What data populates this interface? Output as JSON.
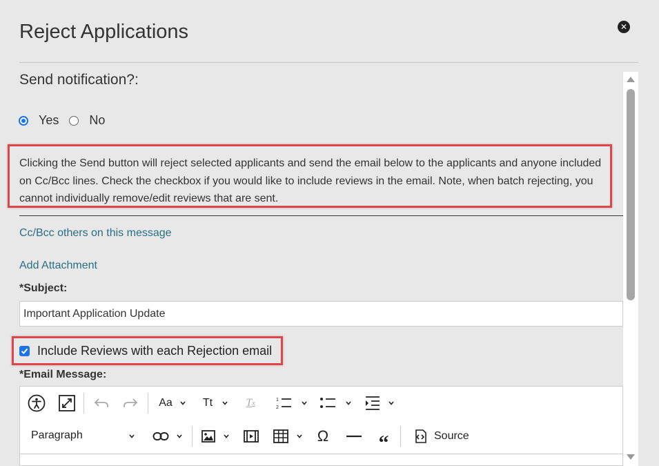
{
  "dialog": {
    "title": "Reject Applications",
    "close_icon": "close-circle-icon"
  },
  "notification": {
    "label": "Send notification?:",
    "options": [
      {
        "label": "Yes",
        "selected": true
      },
      {
        "label": "No",
        "selected": false
      }
    ]
  },
  "info_text": "Clicking the Send button will reject selected applicants and send the email below to the applicants and anyone included on Cc/Bcc lines. Check the checkbox if you would like to include reviews in the email. Note, when batch rejecting, you cannot individually remove/edit reviews that are sent.",
  "links": {
    "cc_bcc": "Cc/Bcc others on this message",
    "attachment": "Add Attachment"
  },
  "subject": {
    "label": "*Subject:",
    "value": "Important Application Update"
  },
  "include_reviews": {
    "label": "Include Reviews with each Rejection email",
    "checked": true
  },
  "email_message": {
    "label": "*Email Message:"
  },
  "toolbar": {
    "font_family_label": "Aa",
    "font_size_label": "Tt",
    "paragraph_label": "Paragraph",
    "source_label": "Source",
    "icons": [
      "accessibility-icon",
      "fullscreen-icon",
      "undo-icon",
      "redo-icon",
      "font-family-icon",
      "font-size-icon",
      "remove-format-icon",
      "numbered-list-icon",
      "bulleted-list-icon",
      "indent-icon",
      "link-icon",
      "image-icon",
      "media-icon",
      "table-icon",
      "special-char-icon",
      "horizontal-line-icon",
      "blockquote-icon",
      "source-icon"
    ]
  },
  "colors": {
    "accent": "#1a73e8",
    "highlight_border": "#e0454a",
    "link": "#2a6f86"
  }
}
